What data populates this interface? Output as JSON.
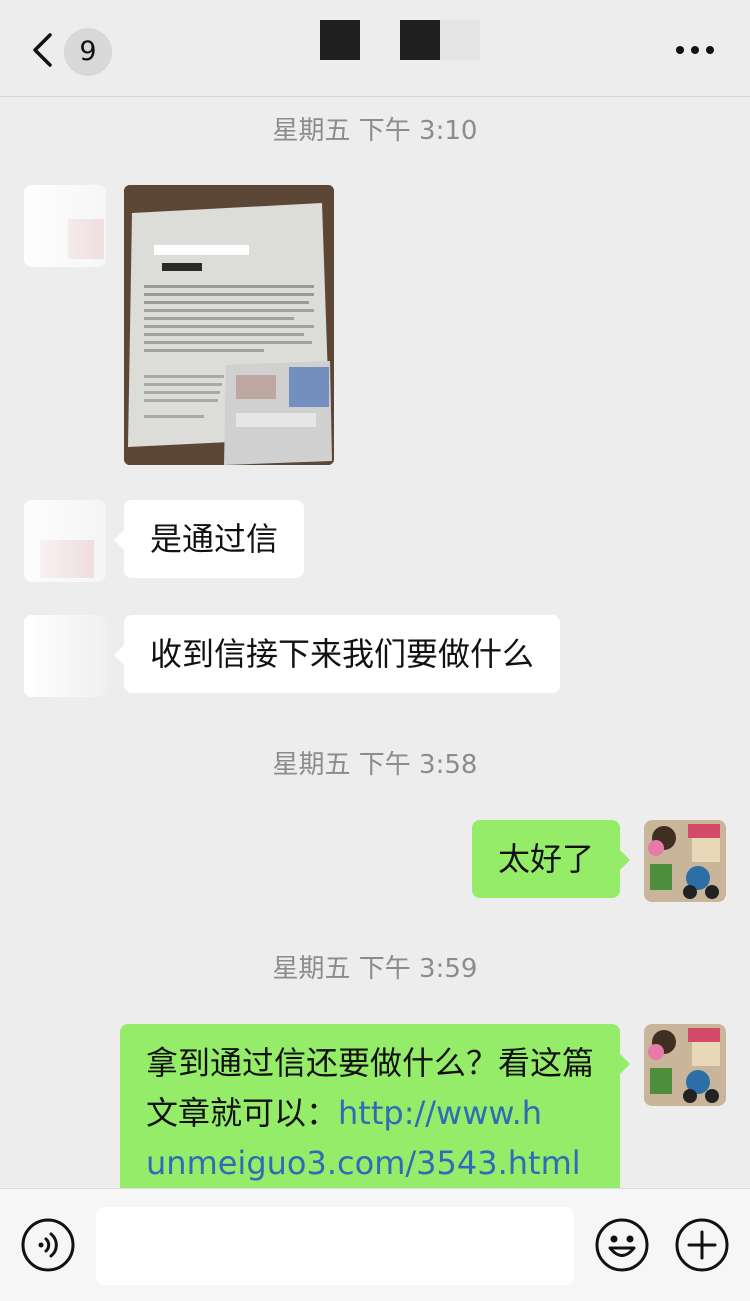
{
  "header": {
    "unread_count": "9",
    "back_icon": "chevron-left-icon",
    "more_icon": "ellipsis-icon"
  },
  "messages": [
    {
      "type": "timestamp",
      "text": "星期五 下午 3:10"
    },
    {
      "type": "image",
      "direction": "incoming",
      "description": "photo-of-document"
    },
    {
      "type": "text",
      "direction": "incoming",
      "text": "是通过信"
    },
    {
      "type": "text",
      "direction": "incoming",
      "text": "收到信接下来我们要做什么"
    },
    {
      "type": "timestamp",
      "text": "星期五 下午 3:58"
    },
    {
      "type": "text",
      "direction": "outgoing",
      "text": "太好了"
    },
    {
      "type": "timestamp",
      "text": "星期五 下午 3:59"
    },
    {
      "type": "text",
      "direction": "outgoing",
      "text_before_link": "拿到通过信还要做什么？看这篇文章就可以：",
      "link_line1": "http://www.h",
      "link_line2": "unmeiguo3.com/3543.html"
    }
  ],
  "input_bar": {
    "voice_icon": "voice-icon",
    "emoji_icon": "emoji-icon",
    "plus_icon": "plus-icon",
    "input_value": ""
  },
  "colors": {
    "background": "#ededed",
    "outgoing_bubble": "#95ec69",
    "incoming_bubble": "#ffffff",
    "link": "#2f6cb7",
    "timestamp": "#8c8c8c"
  }
}
